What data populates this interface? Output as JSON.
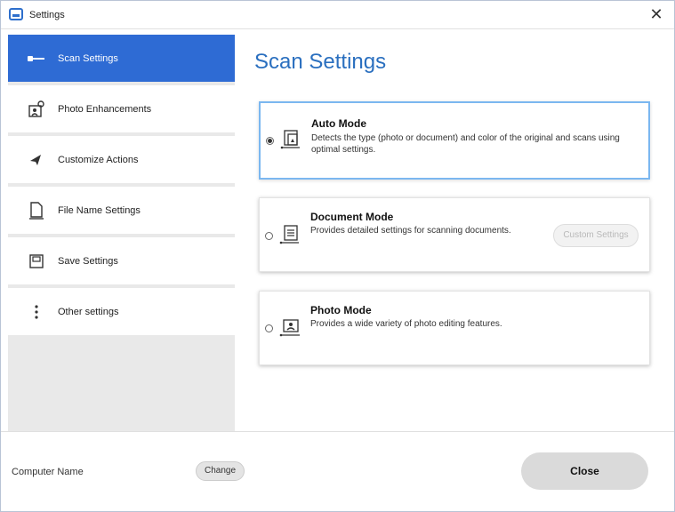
{
  "window": {
    "title": "Settings"
  },
  "sidebar": {
    "items": [
      {
        "label": "Scan Settings",
        "icon": "scanner-icon",
        "active": true
      },
      {
        "label": "Photo Enhancements",
        "icon": "photo-enhance-icon"
      },
      {
        "label": "Customize Actions",
        "icon": "action-arrow-icon"
      },
      {
        "label": "File Name Settings",
        "icon": "file-icon"
      },
      {
        "label": "Save Settings",
        "icon": "save-folder-icon"
      },
      {
        "label": "Other settings",
        "icon": "vertical-dots-icon"
      }
    ]
  },
  "main": {
    "title": "Scan Settings",
    "modes": [
      {
        "name": "Auto Mode",
        "description": "Detects the type (photo or document) and color of the original and scans using optimal settings.",
        "selected": true,
        "icon": "auto-mode-icon"
      },
      {
        "name": "Document Mode",
        "description": "Provides detailed settings for scanning documents.",
        "selected": false,
        "icon": "document-mode-icon",
        "button": "Custom Settings"
      },
      {
        "name": "Photo Mode",
        "description": "Provides a wide variety of photo editing features.",
        "selected": false,
        "icon": "photo-mode-icon"
      }
    ]
  },
  "footer": {
    "computer_name_label": "Computer Name",
    "change_label": "Change",
    "close_label": "Close"
  },
  "colors": {
    "accent": "#2e6bd4",
    "title_blue": "#2a6fbf",
    "selected_border": "#7bb7f0",
    "sidebar_bg": "#e9e9e9"
  }
}
